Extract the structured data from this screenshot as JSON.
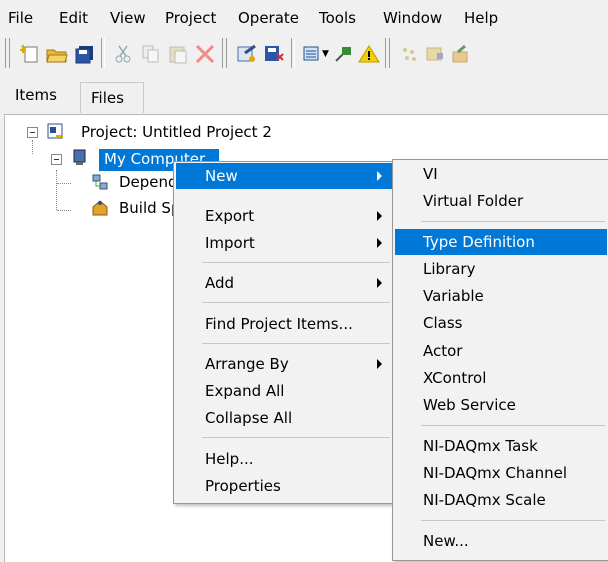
{
  "menubar": [
    "File",
    "Edit",
    "View",
    "Project",
    "Operate",
    "Tools",
    "Window",
    "Help"
  ],
  "tabs": {
    "items": "Items",
    "files": "Files"
  },
  "tree": {
    "project": "Project: Untitled Project 2",
    "computer": "My Computer",
    "dependencies": "Dependencies",
    "build": "Build Specifications"
  },
  "context_menu": {
    "new": "New",
    "export": "Export",
    "import": "Import",
    "add": "Add",
    "find": "Find Project Items...",
    "arrange": "Arrange By",
    "expand": "Expand All",
    "collapse": "Collapse All",
    "help": "Help...",
    "properties": "Properties"
  },
  "submenu": {
    "vi": "VI",
    "folder": "Virtual Folder",
    "typedef": "Type Definition",
    "library": "Library",
    "variable": "Variable",
    "class": "Class",
    "actor": "Actor",
    "xcontrol": "XControl",
    "webservice": "Web Service",
    "daqtask": "NI-DAQmx Task",
    "daqchannel": "NI-DAQmx Channel",
    "daqscale": "NI-DAQmx Scale",
    "newdots": "New..."
  },
  "colors": {
    "highlight": "#0078d7",
    "menu_bg": "#f2f2f2"
  },
  "icons": [
    "new-vi-icon",
    "open-folder-icon",
    "save-all-icon",
    "cut-icon",
    "copy-icon",
    "paste-icon",
    "delete-icon",
    "project-settings-icon",
    "build-icon",
    "view-options-icon",
    "pin-icon",
    "warning-icon",
    "toolbar-extra-icon-1",
    "toolbar-extra-icon-2",
    "toolbar-extra-icon-3"
  ]
}
